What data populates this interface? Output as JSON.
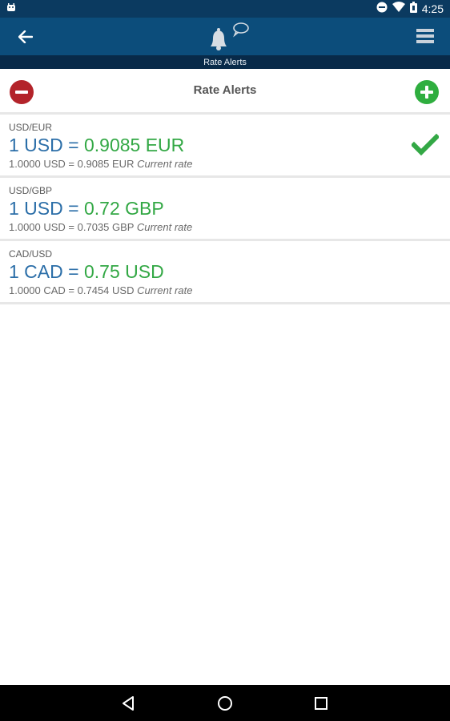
{
  "status_bar": {
    "time": "4:25",
    "icons": [
      "android-icon",
      "do-not-disturb-icon",
      "wifi-icon",
      "battery-icon"
    ]
  },
  "app_bar": {
    "subtitle": "Rate Alerts",
    "icons": [
      "back-arrow-icon",
      "bell-icon",
      "chat-bubble-icon",
      "hamburger-menu-icon"
    ]
  },
  "toolbar": {
    "title": "Rate Alerts",
    "remove_icon": "minus-circle-icon",
    "add_icon": "plus-circle-icon"
  },
  "alerts": [
    {
      "pair": "USD/EUR",
      "base": "1 USD",
      "equals": "=",
      "target": "0.9085 EUR",
      "current": "1.0000 USD = 0.9085 EUR",
      "current_label": "Current rate",
      "triggered": true
    },
    {
      "pair": "USD/GBP",
      "base": "1 USD",
      "equals": "=",
      "target": "0.72 GBP",
      "current": "1.0000 USD = 0.7035 GBP",
      "current_label": "Current rate",
      "triggered": false
    },
    {
      "pair": "CAD/USD",
      "base": "1 CAD",
      "equals": "=",
      "target": "0.75 USD",
      "current": "1.0000 CAD = 0.7454 USD",
      "current_label": "Current rate",
      "triggered": false
    }
  ],
  "colors": {
    "app_bar": "#0c4d7b",
    "status_bar": "#0b3a60",
    "accent_blue": "#2b6ea8",
    "accent_green": "#33a845",
    "remove_red": "#b3232a"
  },
  "nav_bar": {
    "icons": [
      "back-triangle-icon",
      "home-circle-icon",
      "recents-square-icon"
    ]
  }
}
